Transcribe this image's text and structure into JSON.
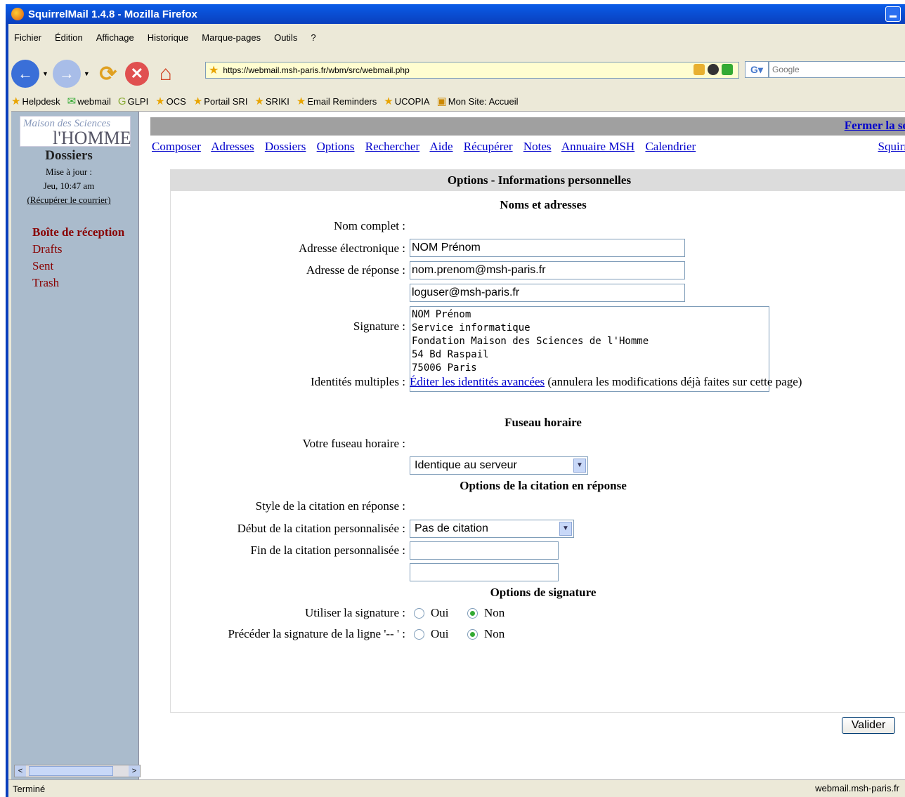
{
  "window": {
    "title": "SquirrelMail 1.4.8 - Mozilla Firefox"
  },
  "menu": [
    "Fichier",
    "Édition",
    "Affichage",
    "Historique",
    "Marque-pages",
    "Outils",
    "?"
  ],
  "url": "https://webmail.msh-paris.fr/wbm/src/webmail.php",
  "search": {
    "placeholder": "Google"
  },
  "bookmarks": [
    "Helpdesk",
    "webmail",
    "GLPI",
    "OCS",
    "Portail SRI",
    "SRIKI",
    "Email Reminders",
    "UCOPIA",
    "Mon Site: Accueil"
  ],
  "sidebar": {
    "logo_top": "Maison des Sciences",
    "logo_bottom": "l'HOMME",
    "title": "Dossiers",
    "updated_label": "Mise à jour :",
    "updated_time": "Jeu, 10:47 am",
    "refresh_link": "(Récupérer le courrier)",
    "folders": [
      "Boîte de réception",
      "Drafts",
      "Sent",
      "Trash"
    ]
  },
  "top": {
    "logout": "Fermer la se",
    "brand_link": "Squirr",
    "nav": [
      "Composer",
      "Adresses",
      "Dossiers",
      "Options",
      "Rechercher",
      "Aide",
      "Récupérer",
      "Notes",
      "Annuaire MSH",
      "Calendrier"
    ]
  },
  "options": {
    "header": "Options - Informations personnelles",
    "names_section": "Noms et adresses",
    "full_name_label": "Nom complet :",
    "full_name": "NOM Prénom",
    "email_label": "Adresse électronique :",
    "email": "nom.prenom@msh-paris.fr",
    "reply_label": "Adresse de réponse :",
    "reply": "loguser@msh-paris.fr",
    "signature_label": "Signature :",
    "signature": "NOM Prénom\nService informatique\nFondation Maison des Sciences de l'Homme\n54 Bd Raspail\n75006 Paris",
    "identities_label": "Identités multiples :",
    "identities_link": "Éditer les identités avancées",
    "identities_note": "(annulera les modifications déjà faites sur cette page)",
    "tz_section": "Fuseau horaire",
    "tz_label": "Votre fuseau horaire :",
    "tz_value": "Identique au serveur",
    "quote_section": "Options de la citation en réponse",
    "quote_style_label": "Style de la citation en réponse :",
    "quote_style": "Pas de citation",
    "quote_start_label": "Début de la citation personnalisée :",
    "quote_end_label": "Fin de la citation personnalisée :",
    "sig_section": "Options de signature",
    "use_sig_label": "Utiliser la signature :",
    "precede_label": "Précéder la signature de la ligne '-- ' :",
    "oui": "Oui",
    "non": "Non",
    "submit": "Valider"
  },
  "status": {
    "left": "Terminé",
    "right": "webmail.msh-paris.fr"
  }
}
